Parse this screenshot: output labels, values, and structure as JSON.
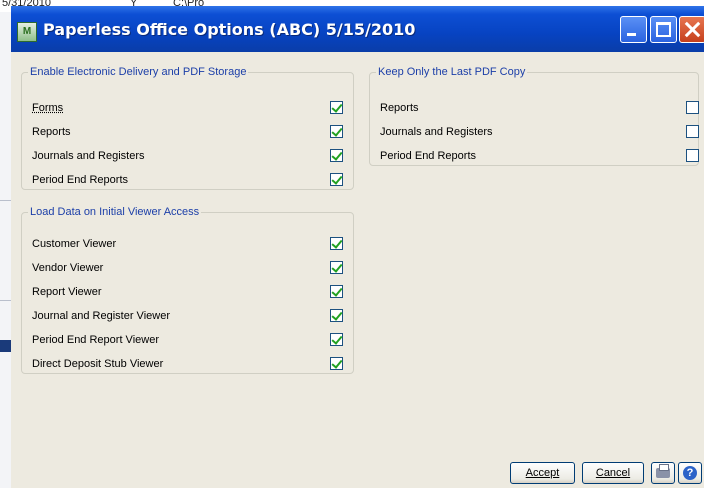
{
  "background": {
    "row": [
      "5/31/2010",
      "Y",
      "C:\\Pro"
    ]
  },
  "dialog": {
    "title": "Paperless Office Options (ABC) 5/15/2010",
    "icon": "sage-mas-app-icon",
    "groups": {
      "electronic_delivery": {
        "legend": "Enable Electronic Delivery and PDF Storage",
        "items": [
          {
            "label": "Forms",
            "checked": true
          },
          {
            "label": "Reports",
            "checked": true
          },
          {
            "label": "Journals and Registers",
            "checked": true
          },
          {
            "label": "Period End Reports",
            "checked": true
          }
        ]
      },
      "last_pdf": {
        "legend": "Keep Only the Last PDF Copy",
        "items": [
          {
            "label": "Reports",
            "checked": false
          },
          {
            "label": "Journals and Registers",
            "checked": false
          },
          {
            "label": "Period End Reports",
            "checked": false
          }
        ]
      },
      "initial_viewer": {
        "legend": "Load Data on Initial Viewer Access",
        "items": [
          {
            "label": "Customer Viewer",
            "checked": true
          },
          {
            "label": "Vendor Viewer",
            "checked": true
          },
          {
            "label": "Report Viewer",
            "checked": true
          },
          {
            "label": "Journal and Register Viewer",
            "checked": true
          },
          {
            "label": "Period End Report Viewer",
            "checked": true
          },
          {
            "label": "Direct Deposit Stub Viewer",
            "checked": true
          }
        ]
      }
    },
    "buttons": {
      "accept": "Accept",
      "cancel": "Cancel",
      "print_icon": "printer-icon",
      "help_icon": "help-icon",
      "help_glyph": "?"
    }
  }
}
